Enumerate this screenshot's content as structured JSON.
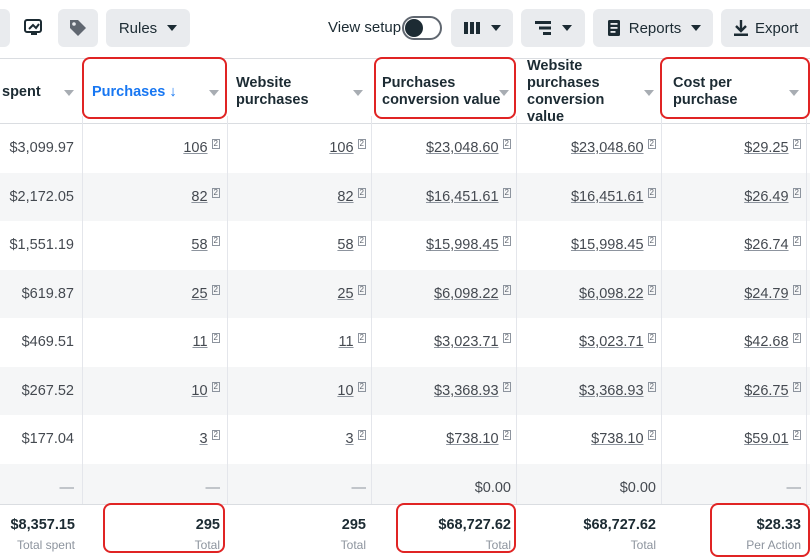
{
  "toolbar": {
    "rules_label": "Rules",
    "view_setup_label": "View setup",
    "reports_label": "Reports",
    "export_label": "Export"
  },
  "columns": [
    {
      "label": "spent"
    },
    {
      "label": "Purchases ↓"
    },
    {
      "label": "Website purchases"
    },
    {
      "label": "Purchases conversion value"
    },
    {
      "label": "Website purchases conversion value"
    },
    {
      "label": "Cost per purchase"
    }
  ],
  "rows": [
    [
      "$3,099.97",
      "106",
      "106",
      "$23,048.60",
      "$23,048.60",
      "$29.25"
    ],
    [
      "$2,172.05",
      "82",
      "82",
      "$16,451.61",
      "$16,451.61",
      "$26.49"
    ],
    [
      "$1,551.19",
      "58",
      "58",
      "$15,998.45",
      "$15,998.45",
      "$26.74"
    ],
    [
      "$619.87",
      "25",
      "25",
      "$6,098.22",
      "$6,098.22",
      "$24.79"
    ],
    [
      "$469.51",
      "11",
      "11",
      "$3,023.71",
      "$3,023.71",
      "$42.68"
    ],
    [
      "$267.52",
      "10",
      "10",
      "$3,368.93",
      "$3,368.93",
      "$26.75"
    ],
    [
      "$177.04",
      "3",
      "3",
      "$738.10",
      "$738.10",
      "$59.01"
    ],
    [
      "—",
      "—",
      "—",
      "$0.00",
      "$0.00",
      "—"
    ]
  ],
  "footnote_mark": "[2]",
  "totals": [
    {
      "value": "$8,357.15",
      "label": "Total spent"
    },
    {
      "value": "295",
      "label": "Total"
    },
    {
      "value": "295",
      "label": "Total"
    },
    {
      "value": "$68,727.62",
      "label": "Total"
    },
    {
      "value": "$68,727.62",
      "label": "Total"
    },
    {
      "value": "$28.33",
      "label": "Per Action"
    }
  ],
  "colors": {
    "highlight": "#e02424",
    "sorted_header": "#1877f2"
  }
}
